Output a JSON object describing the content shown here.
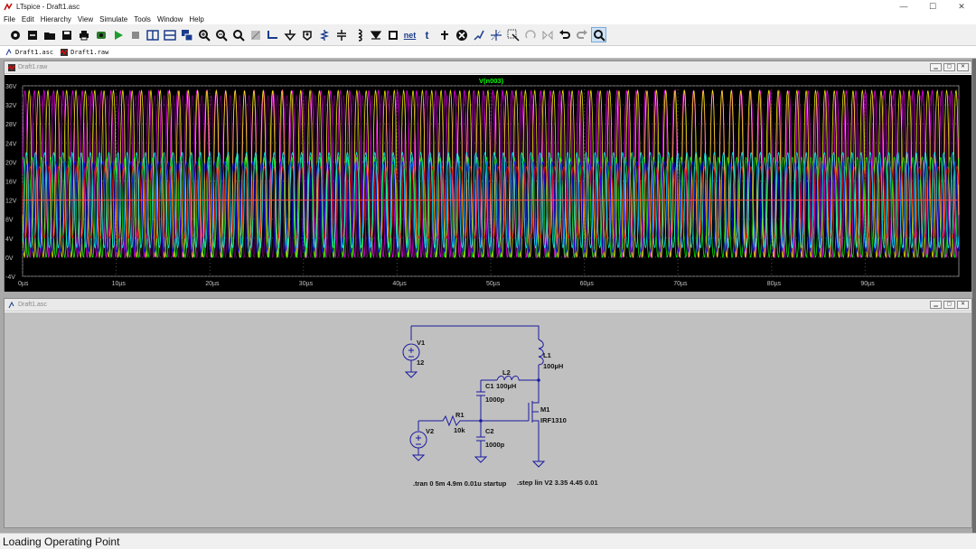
{
  "window": {
    "title": "LTspice - Draft1.asc",
    "controls": [
      "—",
      "☐",
      "✕"
    ]
  },
  "menu": [
    "File",
    "Edit",
    "Hierarchy",
    "View",
    "Simulate",
    "Tools",
    "Window",
    "Help"
  ],
  "toolbar": {
    "net_label": "net",
    "text_label": "t",
    "icons": [
      "settings-icon",
      "new-schematic-icon",
      "open-icon",
      "save-icon",
      "print-icon",
      "control-panel-icon",
      "run-icon",
      "halt-icon",
      "tile-vertical-icon",
      "tile-horizontal-icon",
      "cascade-icon",
      "zoom-in-icon",
      "zoom-out-icon",
      "zoom-fit-icon",
      "autorange-icon",
      "wire-icon",
      "ground-icon",
      "label-icon",
      "resistor-icon",
      "capacitor-icon",
      "inductor-icon",
      "diode-icon",
      "component-icon",
      "net-label",
      "text-label",
      "delete-icon",
      "duplicate-icon",
      "move-icon",
      "drag-icon",
      "mirror-icon",
      "undo-icon",
      "redo-icon",
      "find-icon"
    ]
  },
  "doc_tabs": [
    {
      "label": "Draft1.asc",
      "icon": "schematic-icon"
    },
    {
      "label": "Draft1.raw",
      "icon": "waveform-icon"
    }
  ],
  "waveform_window": {
    "title": "Draft1.raw",
    "trace_label": "V(n003)",
    "trace_label_color": "#00ff00"
  },
  "schematic_window": {
    "title": "Draft1.asc",
    "components": {
      "v1": {
        "name": "V1",
        "value": "12"
      },
      "v2": {
        "name": "V2"
      },
      "l1": {
        "name": "L1",
        "value": "100µH"
      },
      "l2": {
        "name": "L2",
        "value": "100µH"
      },
      "c1": {
        "name": "C1",
        "value": "1000p"
      },
      "c2": {
        "name": "C2",
        "value": "1000p"
      },
      "r1": {
        "name": "R1",
        "value": "10k"
      },
      "m1": {
        "name": "M1",
        "value": "IRF1310"
      }
    },
    "directives": {
      "tran": ".tran 0 5m 4.9m 0.01u startup",
      "step": ".step lin V2 3.35 4.45 0.01"
    }
  },
  "status": "Loading Operating Point",
  "chart_data": {
    "type": "line",
    "title": "V(n003)",
    "xlabel": "",
    "ylabel": "",
    "x_ticks": [
      "0µs",
      "10µs",
      "20µs",
      "30µs",
      "40µs",
      "50µs",
      "60µs",
      "70µs",
      "80µs",
      "90µs"
    ],
    "y_ticks": [
      "36V",
      "32V",
      "28V",
      "24V",
      "20V",
      "16V",
      "12V",
      "8V",
      "4V",
      "0V",
      "-4V"
    ],
    "xlim": [
      0,
      100
    ],
    "ylim": [
      -4,
      36
    ],
    "grid": true,
    "series_note_colors": [
      "#00ff00",
      "#0000ff",
      "#ff0000",
      "#00ffff",
      "#ff00ff",
      "#ffff00",
      "#808080",
      "#800080",
      "#ff8000"
    ],
    "series": [
      {
        "values_desc": "oscillation between 0V and ~35V",
        "color": "#ff00ff"
      },
      {
        "values_desc": "oscillation between 0V and ~35V",
        "color": "#800080"
      },
      {
        "values_desc": "oscillation between 0V and ~35V",
        "color": "#ffff00"
      },
      {
        "values_desc": "oscillation between 0V and ~20V",
        "color": "#00ff00"
      },
      {
        "values_desc": "oscillation between 0V and ~20V",
        "color": "#0000ff"
      },
      {
        "values_desc": "oscillation around 12V",
        "color": "#ff0000"
      },
      {
        "values_desc": "oscillation around 12V",
        "color": "#00ffff"
      }
    ]
  }
}
